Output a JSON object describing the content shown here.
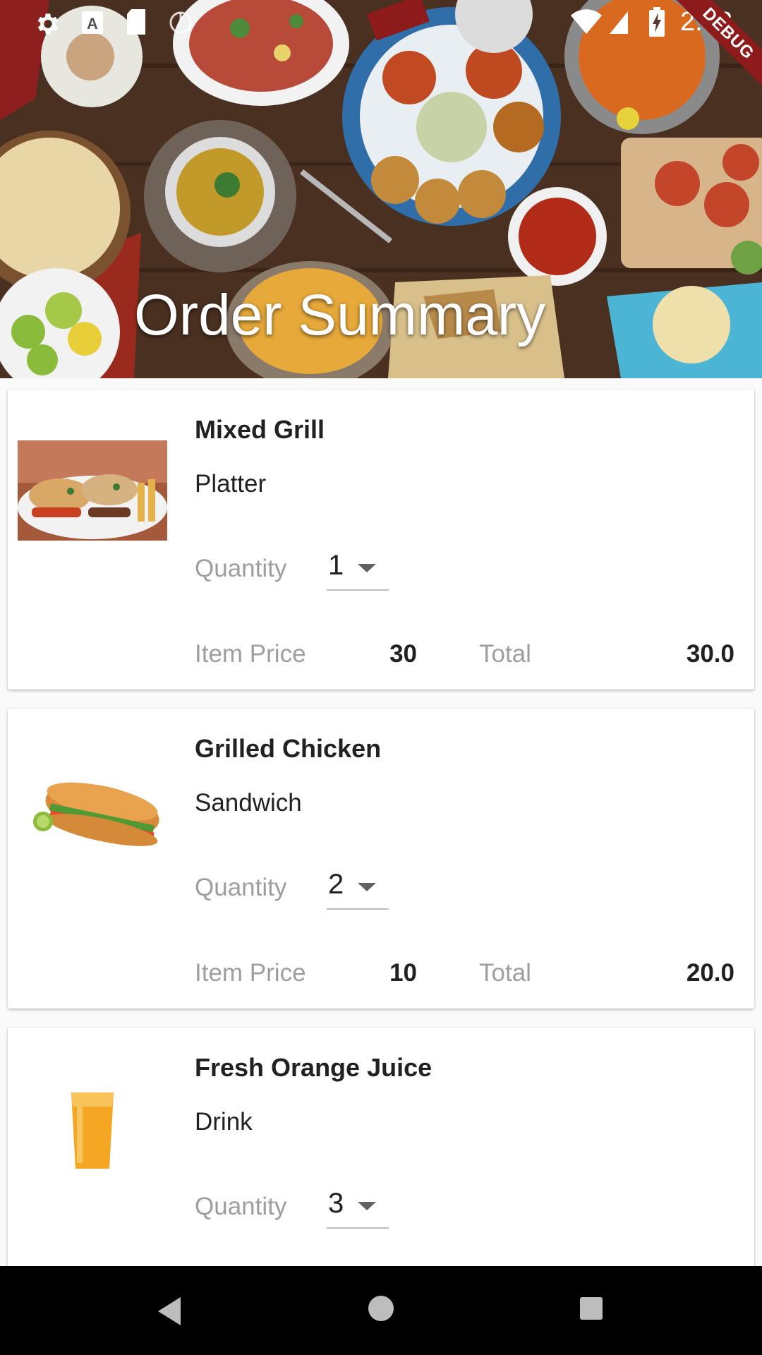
{
  "status_bar": {
    "time": "2:02",
    "debug_label": "DEBUG",
    "icons": [
      "gear-icon",
      "a-icon",
      "sd-card-icon",
      "sync-icon",
      "wifi-icon",
      "signal-icon",
      "battery-charging-icon"
    ]
  },
  "header": {
    "title": "Order Summary"
  },
  "labels": {
    "quantity": "Quantity",
    "item_price": "Item Price",
    "total": "Total"
  },
  "items": [
    {
      "name": "Mixed Grill",
      "type": "Platter",
      "quantity": "1",
      "price": "30",
      "total": "30.0"
    },
    {
      "name": "Grilled Chicken",
      "type": "Sandwich",
      "quantity": "2",
      "price": "10",
      "total": "20.0"
    },
    {
      "name": "Fresh Orange Juice",
      "type": "Drink",
      "quantity": "3"
    }
  ],
  "nav_bar": {
    "icons": [
      "back-icon",
      "home-icon",
      "recent-apps-icon"
    ]
  }
}
